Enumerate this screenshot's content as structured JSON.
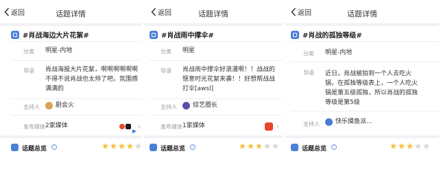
{
  "colors": {
    "accent": "#4a7fd8",
    "star_on": "#f5c242",
    "star_off": "#d8d8d8"
  },
  "panels": [
    {
      "back_label": "返回",
      "title": "话题详情",
      "topic": "#肖战海边大片花絮#",
      "category_label": "分类",
      "category": "明星-内地",
      "intro_label": "导语",
      "intro_lines": [
        "肖战海报大片花絮，啊啊啊啊啊啊",
        "不得不说肖战也太帅了吧，氛围感",
        "满满的"
      ],
      "host_label": "主持人",
      "host_icon": "avatar",
      "host": "剧会火",
      "media_label": "发布媒体",
      "media": "2家媒体",
      "media_icons": [
        "weibo-logo",
        "tiktok-logo",
        "video-logo"
      ],
      "summary_label": "话题总览",
      "rating": 4
    },
    {
      "back_label": "返回",
      "title": "话题详情",
      "topic": "#肖战雨中撑伞#",
      "category_label": "分类",
      "category": "明星",
      "intro_label": "导语",
      "intro_lines": [
        "肖战雨中撑伞好浪漫啊！！战战的",
        "惬意时光花絮来袭！！好想帮战战",
        "打伞[awsl]"
      ],
      "host_label": "主持人",
      "host_icon": "avatar",
      "host": "综艺圈长",
      "media_label": "发布媒体",
      "media": "1家媒体",
      "media_icons": [
        "weibo-logo"
      ],
      "summary_label": "话题总览",
      "rating": 3
    },
    {
      "back_label": "返回",
      "title": "话题详情",
      "topic": "#肖战的孤独等级#",
      "category_label": "分类",
      "category": "明星-内地",
      "intro_label": "导语",
      "intro_lines": [
        "近日，肖战被拍到一个人去吃火",
        "锅，在孤独等级表上，一个人吃火",
        "锅是第五级孤独，所以肖战的孤独",
        "等级是第5级"
      ],
      "host_label": "主持人",
      "host_icon": "avatar",
      "host": "快乐摸鱼派...",
      "summary_label": "话题总览",
      "rating": 3
    }
  ]
}
